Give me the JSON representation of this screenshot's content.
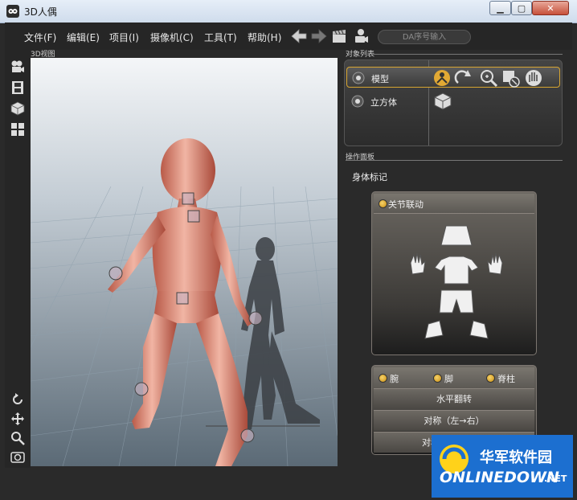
{
  "window": {
    "title": "3D人偶"
  },
  "menu": [
    "文件(F)",
    "编辑(E)",
    "项目(I)",
    "摄像机(C)",
    "工具(T)",
    "帮助(H)"
  ],
  "search": {
    "placeholder": "DA序号输入"
  },
  "viewport": {
    "label": "3D视图"
  },
  "object_list": {
    "label": "对象列表",
    "items": [
      {
        "name": "模型",
        "selected": true
      },
      {
        "name": "立方体",
        "selected": false
      }
    ]
  },
  "operation_panel": {
    "label": "操作面板",
    "body_mark": "身体标记",
    "joint_link": "关节联动",
    "options": [
      "腕",
      "脚",
      "脊柱"
    ],
    "actions": [
      "水平翻转",
      "对称（左→右）",
      "对称（右→左）"
    ],
    "action3_visible": "对称"
  },
  "watermark": {
    "line1": "华军软件园",
    "line2": "ONLINEDOWN",
    "line3": ".NET"
  },
  "colors": {
    "accent": "#d7a531",
    "watermark_bg": "#1c6fd0"
  }
}
